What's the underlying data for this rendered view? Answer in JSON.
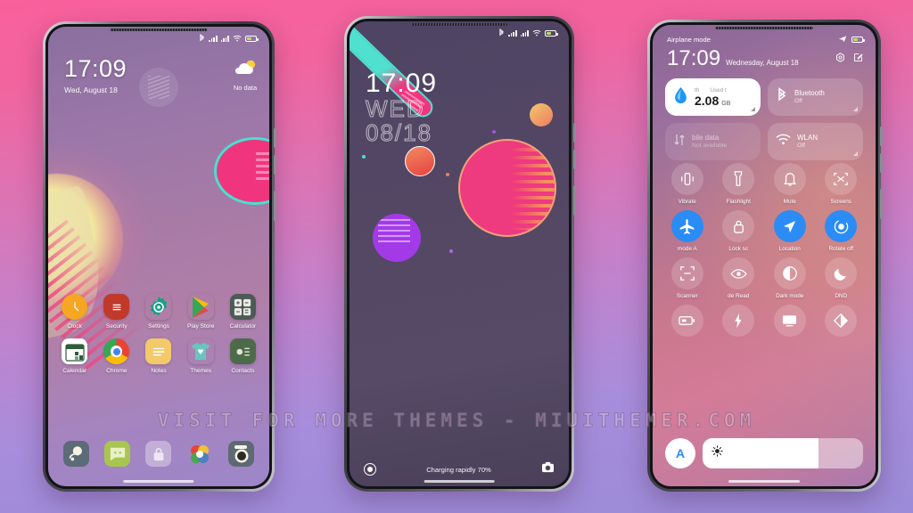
{
  "background": {
    "top_color": "#f9609c",
    "bottom_color": "#9b8bd8"
  },
  "watermark": {
    "text": "VISIT FOR MORE THEMES - MIUITHEMER.COM"
  },
  "accent": {
    "blue": "#2b8cf5",
    "pink": "#f0357e",
    "teal": "#4fe0cf",
    "white": "#ffffff"
  },
  "phone1": {
    "name": "home-screen",
    "status_bar": {
      "icons": [
        "bluetooth-icon",
        "signal-icon",
        "signal-icon",
        "wifi-icon",
        "battery-icon"
      ]
    },
    "clock": "17:09",
    "date": "Wed, August 18",
    "weather": {
      "label": "No data",
      "icon": "partly-cloudy-icon"
    },
    "apps_row1": [
      {
        "label": "Clock",
        "icon": "clock-icon"
      },
      {
        "label": "Security",
        "icon": "shield-icon"
      },
      {
        "label": "Settings",
        "icon": "gear-icon"
      },
      {
        "label": "Play Store",
        "icon": "play-store-icon"
      },
      {
        "label": "Calculator",
        "icon": "calculator-icon"
      }
    ],
    "apps_row2": [
      {
        "label": "Calendar",
        "icon": "calendar-icon"
      },
      {
        "label": "Chrome",
        "icon": "chrome-icon"
      },
      {
        "label": "Notes",
        "icon": "notes-icon"
      },
      {
        "label": "Themes",
        "icon": "themes-shirt-icon"
      },
      {
        "label": "Contacts",
        "icon": "contacts-icon"
      }
    ],
    "dock": [
      {
        "label": "Phone",
        "icon": "phone-icon"
      },
      {
        "label": "Messages",
        "icon": "messages-icon"
      },
      {
        "label": "App lock",
        "icon": "lock-icon"
      },
      {
        "label": "Gallery",
        "icon": "gallery-icon"
      },
      {
        "label": "Camera",
        "icon": "camera-icon"
      }
    ]
  },
  "phone2": {
    "name": "lock-screen",
    "status_bar": {
      "icons": [
        "bluetooth-icon",
        "signal-icon",
        "signal-icon",
        "wifi-icon",
        "battery-icon"
      ]
    },
    "time": "17:09",
    "weekday": "WED",
    "date": "08/18",
    "charging_text": "Charging rapidly 70%",
    "left_shortcut": "flashlight-icon",
    "right_shortcut": "camera-icon"
  },
  "phone3": {
    "name": "control-center",
    "status_left": "Airplane mode",
    "status_icons": [
      "airplane-icon",
      "battery-icon"
    ],
    "time": "17:09",
    "date": "Wednesday, August 18",
    "head_icons": [
      "settings-icon",
      "edit-icon"
    ],
    "big_tiles": [
      {
        "title": "Used t",
        "sub_left": "th",
        "value": "2.08",
        "unit": "GB",
        "icon": "data-drop-icon",
        "style": "light"
      },
      {
        "title": "Bluetooth",
        "sub": "Off",
        "icon": "bluetooth-icon",
        "style": "dark"
      },
      {
        "title": "bile data",
        "sub": "Not available",
        "icon": "mobile-data-icon",
        "style": "dim"
      },
      {
        "title": "WLAN",
        "sub": "Off",
        "icon": "wifi-icon",
        "style": "dark"
      }
    ],
    "toggles_row1": [
      {
        "label": "Vibrate",
        "icon": "vibrate-icon",
        "on": false
      },
      {
        "label": "Flashlight",
        "icon": "flashlight-icon",
        "on": false
      },
      {
        "label": "Mute",
        "icon": "bell-icon",
        "on": false
      },
      {
        "label": "Screens",
        "icon": "screenshot-icon",
        "on": false
      }
    ],
    "toggles_row2": [
      {
        "label": "mode    A",
        "icon": "airplane-icon",
        "on": true
      },
      {
        "label": "Lock sc",
        "icon": "lock-icon",
        "on": false
      },
      {
        "label": "Location",
        "icon": "location-icon",
        "on": true
      },
      {
        "label": "Rotate off",
        "icon": "rotate-icon",
        "on": true
      }
    ],
    "toggles_row3": [
      {
        "label": "Scanner",
        "icon": "scanner-icon",
        "on": false
      },
      {
        "label": "de   Read",
        "icon": "eye-icon",
        "on": false
      },
      {
        "label": "Dark mode",
        "icon": "contrast-icon",
        "on": false
      },
      {
        "label": "DND",
        "icon": "moon-icon",
        "on": false
      }
    ],
    "toggles_row4": [
      {
        "label": "",
        "icon": "battery-saver-icon",
        "on": false
      },
      {
        "label": "",
        "icon": "bolt-icon",
        "on": false
      },
      {
        "label": "",
        "icon": "cast-icon",
        "on": false
      },
      {
        "label": "",
        "icon": "color-contrast-icon",
        "on": false
      }
    ],
    "brightness": {
      "auto_label": "A",
      "icon": "sun-icon",
      "level_percent": 72
    }
  }
}
